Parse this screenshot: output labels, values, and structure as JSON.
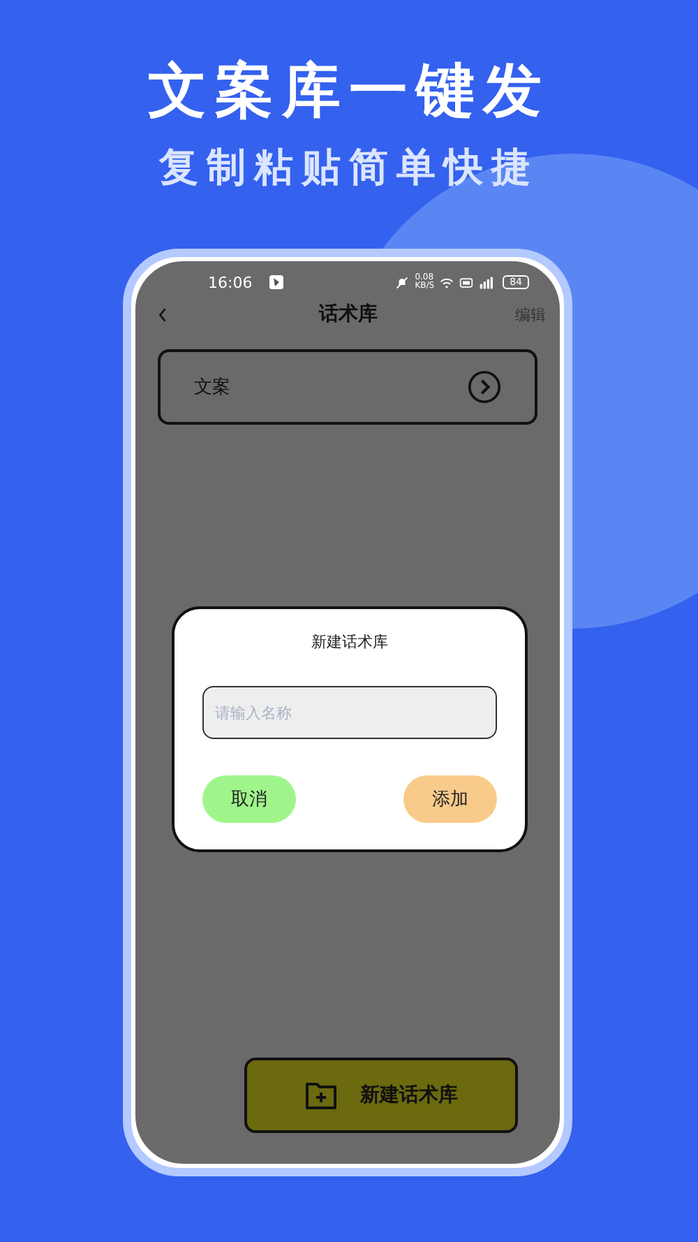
{
  "banner": {
    "title": "文案库一键发",
    "subtitle": "复制粘贴简单快捷"
  },
  "status_bar": {
    "time": "16:06",
    "net_speed": "0.08",
    "net_unit": "KB/S",
    "battery": "84"
  },
  "header": {
    "title": "话术库",
    "action": "编辑"
  },
  "items": [
    {
      "label": "文案"
    }
  ],
  "dialog": {
    "title": "新建话术库",
    "input": {
      "placeholder": "请输入名称"
    },
    "buttons": [
      {
        "label": "取消",
        "kind": "cancel"
      },
      {
        "label": "添加",
        "kind": "confirm"
      }
    ]
  },
  "new_button": {
    "label": "新建话术库"
  }
}
